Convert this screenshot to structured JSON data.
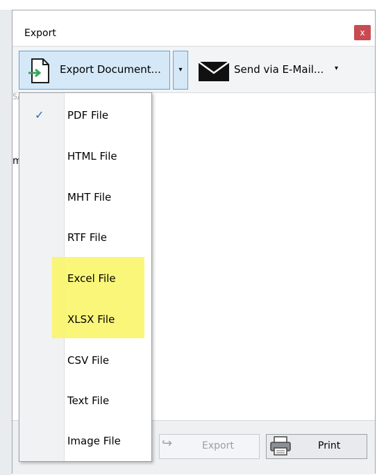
{
  "dialog": {
    "title": "Export",
    "close_label": "x"
  },
  "toolbar": {
    "export_document_label": "Export Document...",
    "split_arrow": "▾",
    "send_email_label": "Send via E-Mail...",
    "send_arrow": "▾"
  },
  "background": {
    "fragment_top": "5/",
    "fragment_left": "m"
  },
  "menu": {
    "selected": "PDF File",
    "check": "✓",
    "items": [
      {
        "label": "PDF File"
      },
      {
        "label": "HTML File"
      },
      {
        "label": "MHT File"
      },
      {
        "label": "RTF File"
      },
      {
        "label": "Excel File"
      },
      {
        "label": "XLSX File"
      },
      {
        "label": "CSV File"
      },
      {
        "label": "Text File"
      },
      {
        "label": "Image File"
      }
    ],
    "highlight_color": "#faf56a"
  },
  "footer": {
    "export_label": "Export",
    "print_label": "Print"
  },
  "colors": {
    "accent_border": "#5fa3d6",
    "accent_fill": "#d5e8f7",
    "close_red": "#c74b50",
    "check_blue": "#1e6fbf"
  }
}
